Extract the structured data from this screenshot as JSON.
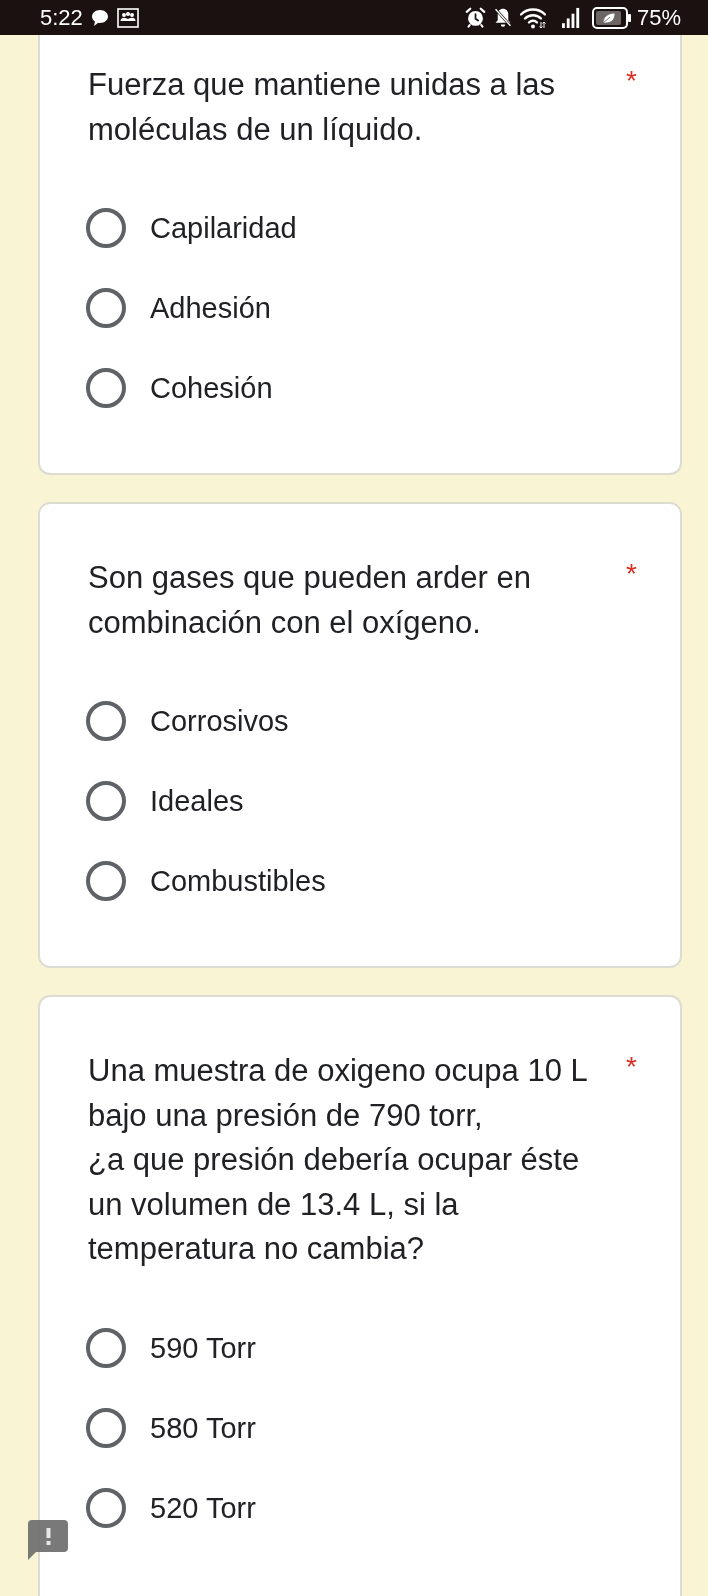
{
  "status_bar": {
    "time": "5:22",
    "battery": "75%"
  },
  "questions": [
    {
      "text": "Fuerza que mantiene unidas a las moléculas de un líquido.",
      "required_mark": "*",
      "options": [
        {
          "label": "Capilaridad",
          "selected": false
        },
        {
          "label": "Adhesión",
          "selected": false
        },
        {
          "label": "Cohesión",
          "selected": false
        }
      ]
    },
    {
      "text": "Son gases que pueden arder en combinación con el oxígeno.",
      "required_mark": "*",
      "options": [
        {
          "label": "Corrosivos",
          "selected": false
        },
        {
          "label": "Ideales",
          "selected": false
        },
        {
          "label": "Combustibles",
          "selected": false
        }
      ]
    },
    {
      "text": "Una muestra de oxigeno ocupa 10 L\nbajo una presión de 790 torr,\n¿a que presión debería ocupar éste\nun volumen de 13.4 L, si la\ntemperatura no cambia?",
      "required_mark": "*",
      "options": [
        {
          "label": "590 Torr",
          "selected": false
        },
        {
          "label": "580 Torr",
          "selected": false
        },
        {
          "label": "520 Torr",
          "selected": false
        }
      ]
    }
  ]
}
